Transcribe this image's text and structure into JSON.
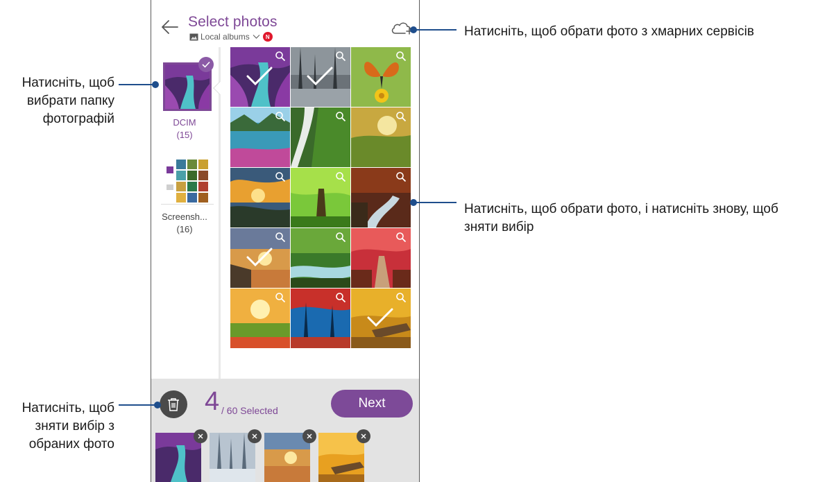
{
  "header": {
    "title": "Select photos",
    "source_label": "Local albums",
    "new_badge": "N"
  },
  "folders": [
    {
      "name": "DCIM",
      "count": "(15)",
      "selected": true
    },
    {
      "name": "Screensh...",
      "count": "(16)",
      "selected": false
    }
  ],
  "grid": {
    "photos": [
      {
        "icon": "purple-river-photo",
        "selected": true
      },
      {
        "icon": "snowy-forest-photo",
        "selected": true
      },
      {
        "icon": "butterfly-flower-photo",
        "selected": false
      },
      {
        "icon": "lake-flowers-photo",
        "selected": false
      },
      {
        "icon": "waterfall-moss-photo",
        "selected": false
      },
      {
        "icon": "sunset-meadow-photo",
        "selected": false
      },
      {
        "icon": "cloudy-sunset-river-photo",
        "selected": false
      },
      {
        "icon": "green-tree-photo",
        "selected": false
      },
      {
        "icon": "autumn-creek-photo",
        "selected": false
      },
      {
        "icon": "pier-sunset-photo",
        "selected": true
      },
      {
        "icon": "forest-stream-photo",
        "selected": false
      },
      {
        "icon": "red-tree-path-photo",
        "selected": false
      },
      {
        "icon": "sunrise-field-photo",
        "selected": false
      },
      {
        "icon": "blue-red-forest-photo",
        "selected": false
      },
      {
        "icon": "autumn-bench-photo",
        "selected": true
      }
    ]
  },
  "bottom_bar": {
    "selected_count": "4",
    "selected_suffix": "/ 60 Selected",
    "next_label": "Next",
    "selected_thumbs": [
      {
        "icon": "purple-river-photo"
      },
      {
        "icon": "snowy-forest-photo"
      },
      {
        "icon": "pier-sunset-photo"
      },
      {
        "icon": "autumn-bench-photo"
      }
    ]
  },
  "callouts": {
    "cloud": "Натисніть, щоб обрати фото з хмарних сервісів",
    "folder_line1": "Натисніть, щоб",
    "folder_line2": "вибрати папку",
    "folder_line3": "фотографій",
    "grid_line1": "Натисніть, щоб обрати фото, і натисніть знову, щоб",
    "grid_line2": "зняти вибір",
    "trash_line1": "Натисніть, щоб",
    "trash_line2": "зняти вибір з",
    "trash_line3": "обраних фото"
  },
  "colors": {
    "accent": "#7e4896",
    "callout_line": "#1f4e8c",
    "bottom_bar": "#e3e3e3",
    "badge": "#e0182c"
  }
}
